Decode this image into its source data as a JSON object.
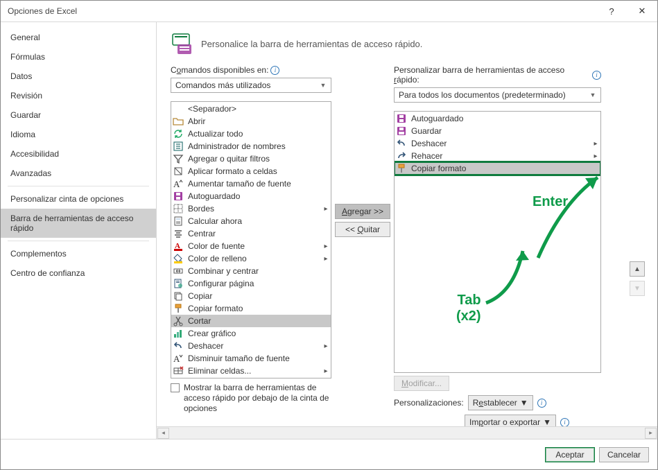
{
  "window": {
    "title": "Opciones de Excel",
    "help_symbol": "?",
    "close_symbol": "✕"
  },
  "nav": {
    "items": [
      {
        "label": "General"
      },
      {
        "label": "Fórmulas"
      },
      {
        "label": "Datos"
      },
      {
        "label": "Revisión"
      },
      {
        "label": "Guardar"
      },
      {
        "label": "Idioma"
      },
      {
        "label": "Accesibilidad"
      },
      {
        "label": "Avanzadas"
      }
    ],
    "items2": [
      {
        "label": "Personalizar cinta de opciones"
      },
      {
        "label": "Barra de herramientas de acceso rápido",
        "selected": true
      }
    ],
    "items3": [
      {
        "label": "Complementos"
      },
      {
        "label": "Centro de confianza"
      }
    ]
  },
  "main": {
    "header": "Personalice la barra de herramientas de acceso rápido.",
    "left": {
      "label_pre": "C",
      "label_ul": "o",
      "label_post": "mandos disponibles en:",
      "combo": "Comandos más utilizados",
      "items": [
        {
          "icon": "separator",
          "label": "<Separador>"
        },
        {
          "icon": "folder-open",
          "label": "Abrir"
        },
        {
          "icon": "refresh-all",
          "label": "Actualizar todo"
        },
        {
          "icon": "name-manager",
          "label": "Administrador de nombres"
        },
        {
          "icon": "filter",
          "label": "Agregar o quitar filtros"
        },
        {
          "icon": "apply-format",
          "label": "Aplicar formato a celdas"
        },
        {
          "icon": "font-grow",
          "label": "Aumentar tamaño de fuente"
        },
        {
          "icon": "autosave",
          "label": "Autoguardado",
          "color": "#a340a3"
        },
        {
          "icon": "borders",
          "label": "Bordes",
          "submenu": true
        },
        {
          "icon": "calculator",
          "label": "Calcular ahora"
        },
        {
          "icon": "center",
          "label": "Centrar"
        },
        {
          "icon": "font-color",
          "label": "Color de fuente",
          "submenu": true
        },
        {
          "icon": "fill-color",
          "label": "Color de relleno",
          "submenu": true
        },
        {
          "icon": "merge-center",
          "label": "Combinar y centrar"
        },
        {
          "icon": "page-setup",
          "label": "Configurar página"
        },
        {
          "icon": "copy",
          "label": "Copiar"
        },
        {
          "icon": "format-painter",
          "label": "Copiar formato"
        },
        {
          "icon": "cut",
          "label": "Cortar",
          "selected": true
        },
        {
          "icon": "chart",
          "label": "Crear gráfico"
        },
        {
          "icon": "undo",
          "label": "Deshacer",
          "submenu": true
        },
        {
          "icon": "font-shrink",
          "label": "Disminuir tamaño de fuente"
        },
        {
          "icon": "delete-cells",
          "label": "Eliminar celdas...",
          "submenu": true
        }
      ]
    },
    "right": {
      "label_pre": "Personalizar barra de herramientas de acceso ",
      "label_ul": "r",
      "label_post": "ápido:",
      "combo": "Para todos los documentos (predeterminado)",
      "items": [
        {
          "icon": "autosave",
          "label": "Autoguardado",
          "color": "#a340a3"
        },
        {
          "icon": "save",
          "label": "Guardar",
          "color": "#a340a3"
        },
        {
          "icon": "undo",
          "label": "Deshacer",
          "submenu": true
        },
        {
          "icon": "redo",
          "label": "Rehacer",
          "submenu": true
        },
        {
          "icon": "format-painter",
          "label": "Copiar formato",
          "highlight": true
        }
      ]
    },
    "buttons": {
      "add_pre": "",
      "add_ul": "A",
      "add_post": "gregar >>",
      "remove_pre": "<< ",
      "remove_ul": "Q",
      "remove_post": "uitar"
    },
    "modify": {
      "label_ul": "M",
      "label_post": "odificar..."
    },
    "checkbox": {
      "text": "Mostrar la barra de herramientas de acceso rápido por debajo de la cinta de opciones"
    },
    "custom": {
      "label": "Personalizaciones:",
      "reset_pre": "R",
      "reset_ul": "e",
      "reset_post": "stablecer",
      "import_pre": "Im",
      "import_ul": "p",
      "import_post": "ortar o exportar"
    },
    "annotations": {
      "tab": "Tab",
      "x2": "(x2)",
      "enter": "Enter"
    }
  },
  "footer": {
    "ok": "Aceptar",
    "cancel": "Cancelar"
  }
}
